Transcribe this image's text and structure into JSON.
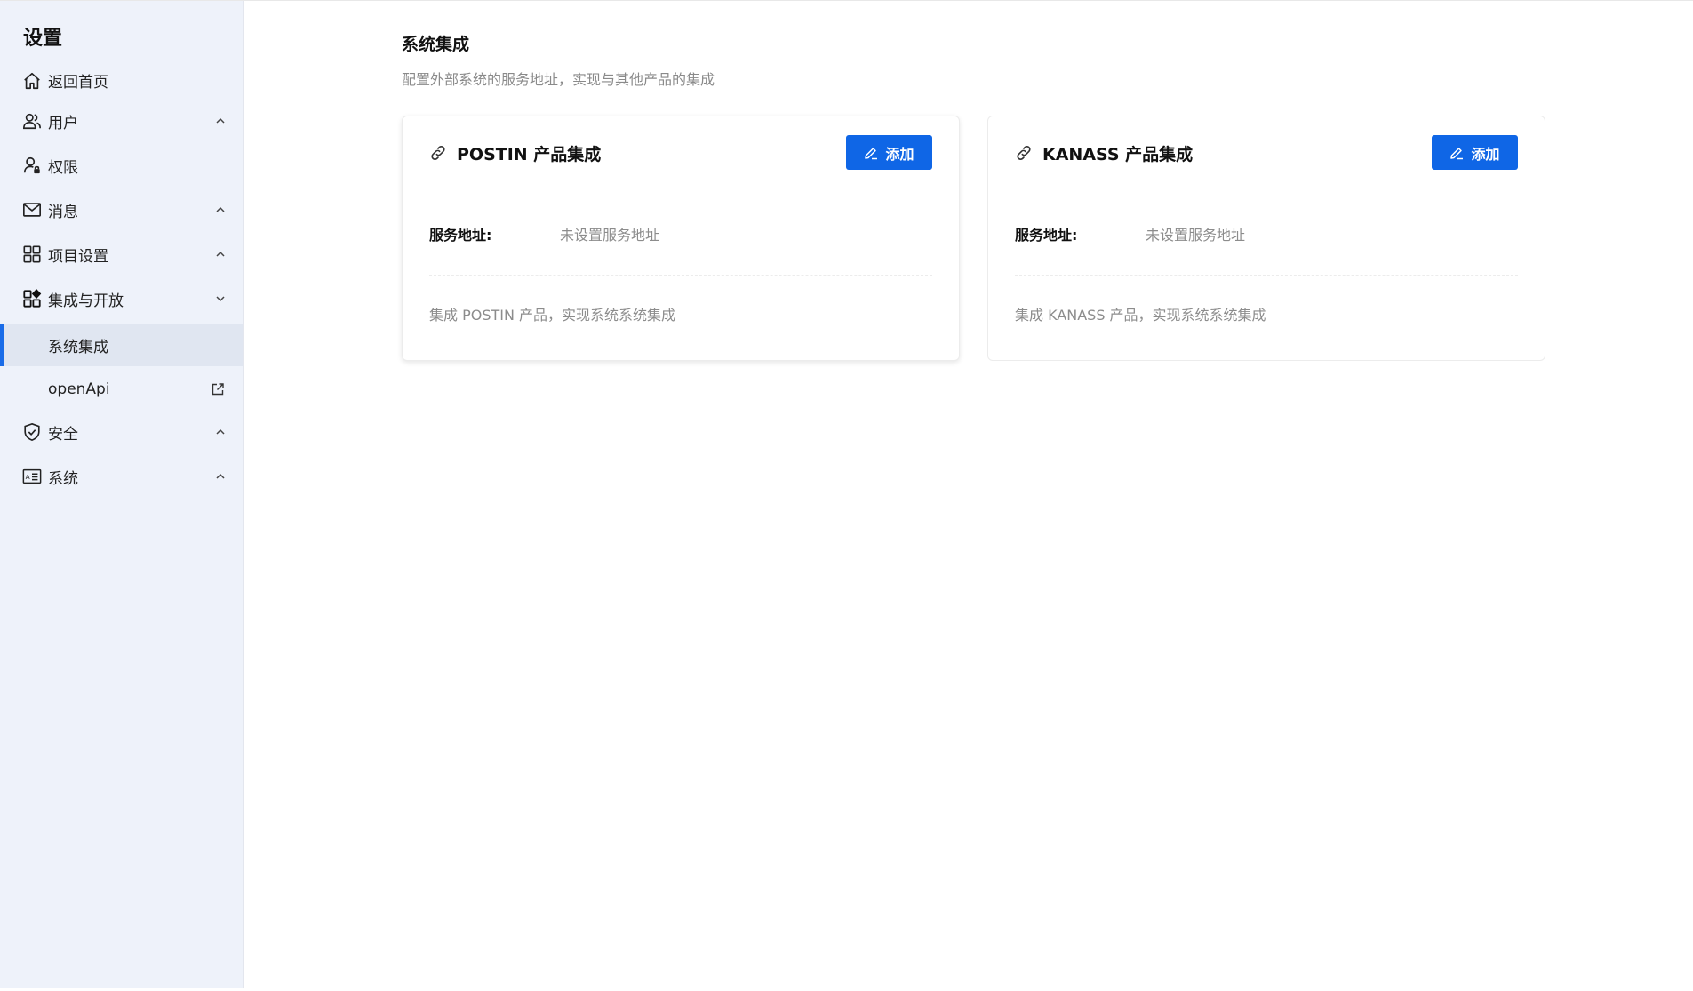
{
  "sidebar": {
    "title": "设置",
    "back_home": "返回首页",
    "items": [
      {
        "label": "用户",
        "icon": "users-icon",
        "chevron": "up"
      },
      {
        "label": "权限",
        "icon": "user-lock-icon",
        "chevron": ""
      },
      {
        "label": "消息",
        "icon": "mail-icon",
        "chevron": "up"
      },
      {
        "label": "项目设置",
        "icon": "grid-icon",
        "chevron": "up"
      },
      {
        "label": "集成与开放",
        "icon": "apps-icon",
        "chevron": "down"
      },
      {
        "label": "系统集成",
        "icon": "",
        "chevron": "",
        "active": true
      },
      {
        "label": "openApi",
        "icon": "",
        "chevron": "",
        "external": true
      },
      {
        "label": "安全",
        "icon": "shield-icon",
        "chevron": "up"
      },
      {
        "label": "系统",
        "icon": "id-card-icon",
        "chevron": "up"
      }
    ]
  },
  "main": {
    "title": "系统集成",
    "description": "配置外部系统的服务地址，实现与其他产品的集成",
    "cards": [
      {
        "title": "POSTIN 产品集成",
        "add_label": "添加",
        "field_label": "服务地址:",
        "field_value": "未设置服务地址",
        "description": "集成 POSTIN 产品，实现系统系统集成"
      },
      {
        "title": "KANASS 产品集成",
        "add_label": "添加",
        "field_label": "服务地址:",
        "field_value": "未设置服务地址",
        "description": "集成 KANASS 产品，实现系统系统集成"
      }
    ]
  },
  "colors": {
    "accent": "#0f66e6",
    "sidebar_bg": "#eef2fa",
    "active_bar": "#1a6ce8"
  }
}
